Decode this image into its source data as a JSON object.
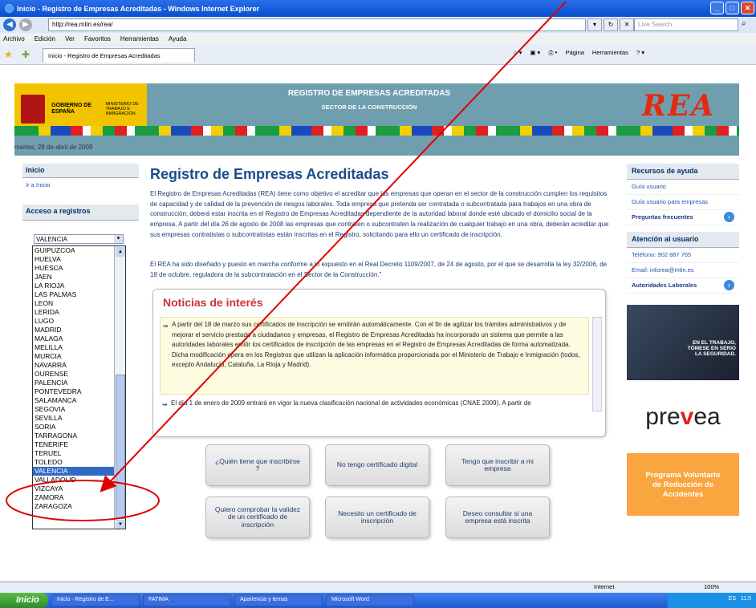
{
  "window": {
    "title": "Inicio - Registro de Empresas Acreditadas - Windows Internet Explorer",
    "url": "http://rea.mtin.es/rea/",
    "search_placeholder": "Live Search",
    "tab_title": "Inicio - Registro de Empresas Acreditadas",
    "menu": [
      "Archivo",
      "Edición",
      "Ver",
      "Favoritos",
      "Herramientas",
      "Ayuda"
    ],
    "cmd": [
      "Página",
      "Herramientas"
    ],
    "status_zone": "Internet",
    "zoom": "100%"
  },
  "taskbar": {
    "start": "Inicio",
    "items": [
      "Inicio - Registro de E...",
      "FATIMA",
      "Apariencia y temas",
      "Microsoft Word"
    ],
    "tray_lang": "ES",
    "tray_time": "11:5"
  },
  "banner": {
    "gov": "GOBIERNO DE ESPAÑA",
    "ministry": "MINISTERIO DE TRABAJO E INMIGRACIÓN",
    "title": "REGISTRO DE EMPRESAS ACREDITADAS",
    "subtitle": "SECTOR DE LA CONSTRUCCIÓN",
    "logo": "REA"
  },
  "date": "martes, 28 de abril de 2009",
  "left": {
    "inicio_head": "Inicio",
    "inicio_link": "Ir a Inicio",
    "acceso_head": "Acceso a registros",
    "select_value": "VALENCIA",
    "dropdown_items": [
      "GUIPUZCOA",
      "HUELVA",
      "HUESCA",
      "JAEN",
      "LA RIOJA",
      "LAS PALMAS",
      "LEON",
      "LERIDA",
      "LUGO",
      "MADRID",
      "MALAGA",
      "MELILLA",
      "MURCIA",
      "NAVARRA",
      "OURENSE",
      "PALENCIA",
      "PONTEVEDRA",
      "SALAMANCA",
      "SEGOVIA",
      "SEVILLA",
      "SORIA",
      "TARRAGONA",
      "TENERIFE",
      "TERUEL",
      "TOLEDO",
      "VALENCIA",
      "VALLADOLID",
      "VIZCAYA",
      "ZAMORA",
      "ZARAGOZA"
    ],
    "selected_item": "VALENCIA"
  },
  "main": {
    "title": "Registro de Empresas Acreditadas",
    "intro": "El Registro de Empresas Acreditadas (REA) tiene como objetivo el acreditar que las empresas que operan en el sector de la construcción cumplen los requisitos de capacidad y de calidad de la prevención de riesgos laborales. Toda empresa que pretenda ser contratada o subcontratada para trabajos en una obra de construcción, deberá estar inscrita en el Registro de Empresas Acreditadas dependiente de la autoridad laboral donde esté ubicado el domicilio social de la empresa. A partir del día 26 de agosto de 2008 las empresas que contraten o subcontraten la realización de cualquier trabajo en una obra, deberán acreditar que sus empresas contratistas o subcontratistas están inscritas en el Registro, solicitando para ello un certificado de inscripción.",
    "intro2": "El REA ha sido diseñado y puesto en marcha conforme a lo expuesto en el Real Decreto 1109/2007, de 24 de agosto, por el que se desarrolla la ley 32/2006, de 18 de octubre, reguladora de la subcontratación en el Sector de la Construcción.\"",
    "news_title": "Noticias de interés",
    "news1": "A partir del 18 de marzo sus certificados de inscripción se emitirán automáticamente. Con el fin de agilizar los trámites administrativos y de mejorar el servicio prestado a ciudadanos y empresas, el Registro de Empresas Acreditadas ha incorporado un sistema que permite a las autoridades laborales emitir los certificados de inscripción de las empresas en el Registro de Empresas Acreditadas de forma automatizada. Dicha modificación opera en los Registros que utilizan la aplicación informática proporcionada por el Ministerio de Trabajo e Inmigración (todos, excepto Andalucía, Cataluña, La Rioja y Madrid).",
    "news2": "El día 1 de enero de 2009 entrará en vigor la nueva clasificación nacional de actividades económicas (CNAE 2009). A partir de",
    "buttons": [
      "¿Quién tiene que inscribirse ?",
      "No tengo certificado digital",
      "Tengo que inscribir a mi empresa",
      "Quiero comprobar la validez de un certificado de inscripción",
      "Necesito un certificado de inscripción",
      "Deseo consultar si una empresa está inscrita"
    ]
  },
  "right": {
    "recursos_head": "Recursos de ayuda",
    "links": [
      "Guía usuario",
      "Guía usuario para empresas",
      "Preguntas frecuentes"
    ],
    "atencion_head": "Atención al usuario",
    "phone": "Teléfono: 902 887 765",
    "email": "Email: inforea@mtin.es",
    "autoridades": "Autoridades Laborales",
    "photo_text": "EN EL TRABAJO, TÓMESE EN SERIO LA SEGURIDAD.",
    "prevea_pre": "pre",
    "prevea_v": "v",
    "prevea_post": "ea",
    "programa": "Programa Voluntario de Reducción de Accidentes"
  },
  "colors": {
    "accent": "#1e4a8a",
    "selected": "#316ac5",
    "annotation": "#e00000"
  }
}
